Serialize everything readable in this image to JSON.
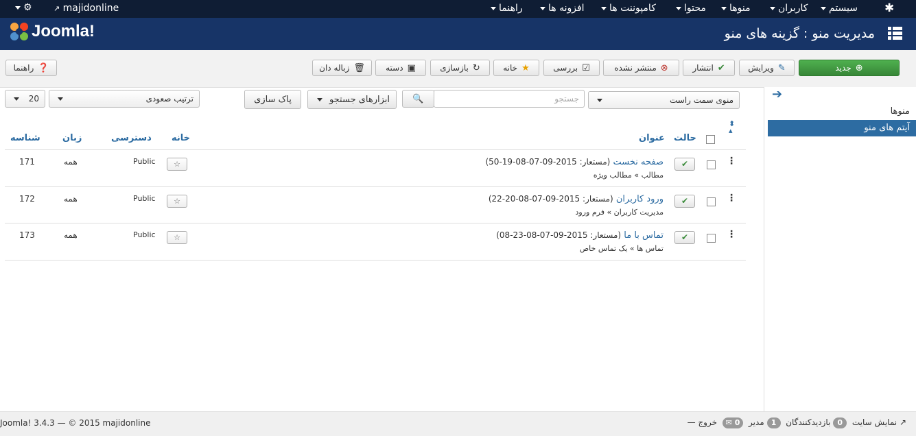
{
  "topnav": {
    "site_name": "majidonline",
    "menus": [
      "سیستم",
      "کاربران",
      "منوها",
      "محتوا",
      "کامپوننت ها",
      "افزونه ها",
      "راهنما"
    ]
  },
  "header": {
    "logo": "Joomla!",
    "title": "مدیریت منو : گزینه های منو"
  },
  "toolbar": {
    "new": "جدید",
    "edit": "ویرایش",
    "publish": "انتشار",
    "unpublish": "منتشر نشده",
    "checkin": "بررسی",
    "home": "خانه",
    "rebuild": "بازسازی",
    "batch": "دسته",
    "trash": "زباله دان",
    "help": "راهنما"
  },
  "sidebar": {
    "items": [
      {
        "label": "منوها"
      },
      {
        "label": "آیتم های منو"
      }
    ]
  },
  "filters": {
    "menu_select": "منوی سمت راست",
    "search_placeholder": "جستجو",
    "search_tools": "ابزارهای جستجو",
    "clear": "پاک سازی",
    "ordering": "ترتیب صعودی",
    "limit": "20"
  },
  "table": {
    "headers": {
      "status": "حالت",
      "title": "عنوان",
      "home": "خانه",
      "access": "دسترسی",
      "language": "زبان",
      "id": "شناسه"
    },
    "rows": [
      {
        "title": "صفحه نخست",
        "alias": "(مستعار: 2015-09-07-08-19-50)",
        "sub": "مطالب » مطالب ویژه",
        "access": "Public",
        "language": "همه",
        "id": "171"
      },
      {
        "title": "ورود کاربران",
        "alias": "(مستعار: 2015-09-07-08-20-22)",
        "sub": "مدیریت کاربران » فرم ورود",
        "access": "Public",
        "language": "همه",
        "id": "172"
      },
      {
        "title": "تماس با ما",
        "alias": "(مستعار: 2015-09-07-08-23-08)",
        "sub": "تماس ها » یک تماس خاص",
        "access": "Public",
        "language": "همه",
        "id": "173"
      }
    ]
  },
  "footer": {
    "view_site": "نمایش سایت",
    "visitors_count": "0",
    "visitors_label": "بازدیدکنندگان",
    "admins_count": "1",
    "admins_label": "مدیر",
    "messages_count": "0",
    "logout": "خروج",
    "copyright": "Joomla! 3.4.3 — © 2015 majidonline"
  },
  "colors": {
    "topnav": "#0f1d34",
    "header": "#173467",
    "accent": "#2d6ca2",
    "new_button": "#46a546"
  }
}
